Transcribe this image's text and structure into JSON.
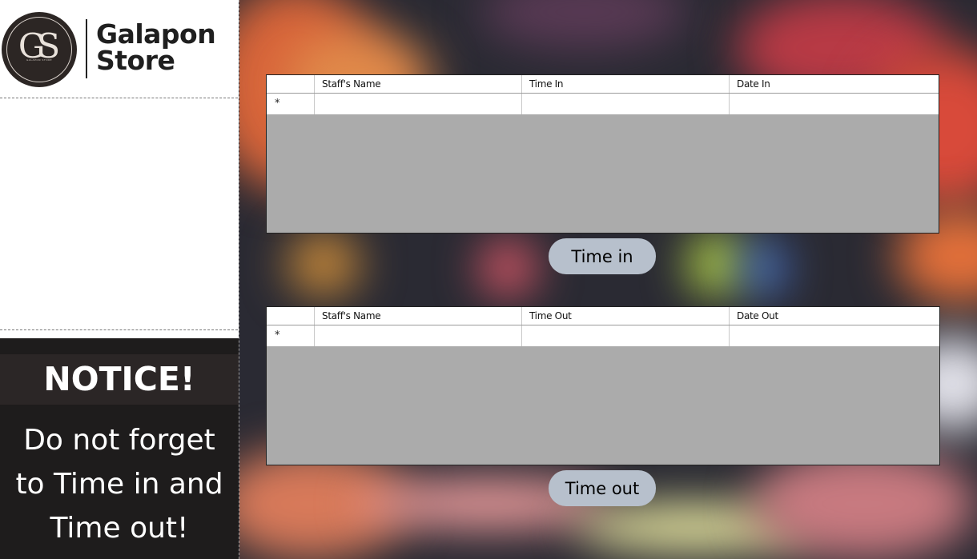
{
  "brand": {
    "monogram": "GS",
    "monogram_caption": "GALAPON STORE",
    "name_line1": "Galapon",
    "name_line2": "Store"
  },
  "notice": {
    "title": "NOTICE!",
    "lines": [
      "Do not forget",
      "to Time in and",
      "Time out!"
    ]
  },
  "time_in_grid": {
    "columns": [
      "",
      "Staff's Name",
      "Time In",
      "Date In"
    ],
    "new_row_marker": "*"
  },
  "time_in_button": {
    "label": "Time in"
  },
  "time_out_grid": {
    "columns": [
      "",
      "Staff's Name",
      "Time Out",
      "Date Out"
    ],
    "new_row_marker": "*"
  },
  "time_out_button": {
    "label": "Time out"
  },
  "colors": {
    "grid_empty_area": "#ababab",
    "button_bg": "#b7c0cc",
    "notice_bg": "#1e1c1c"
  }
}
